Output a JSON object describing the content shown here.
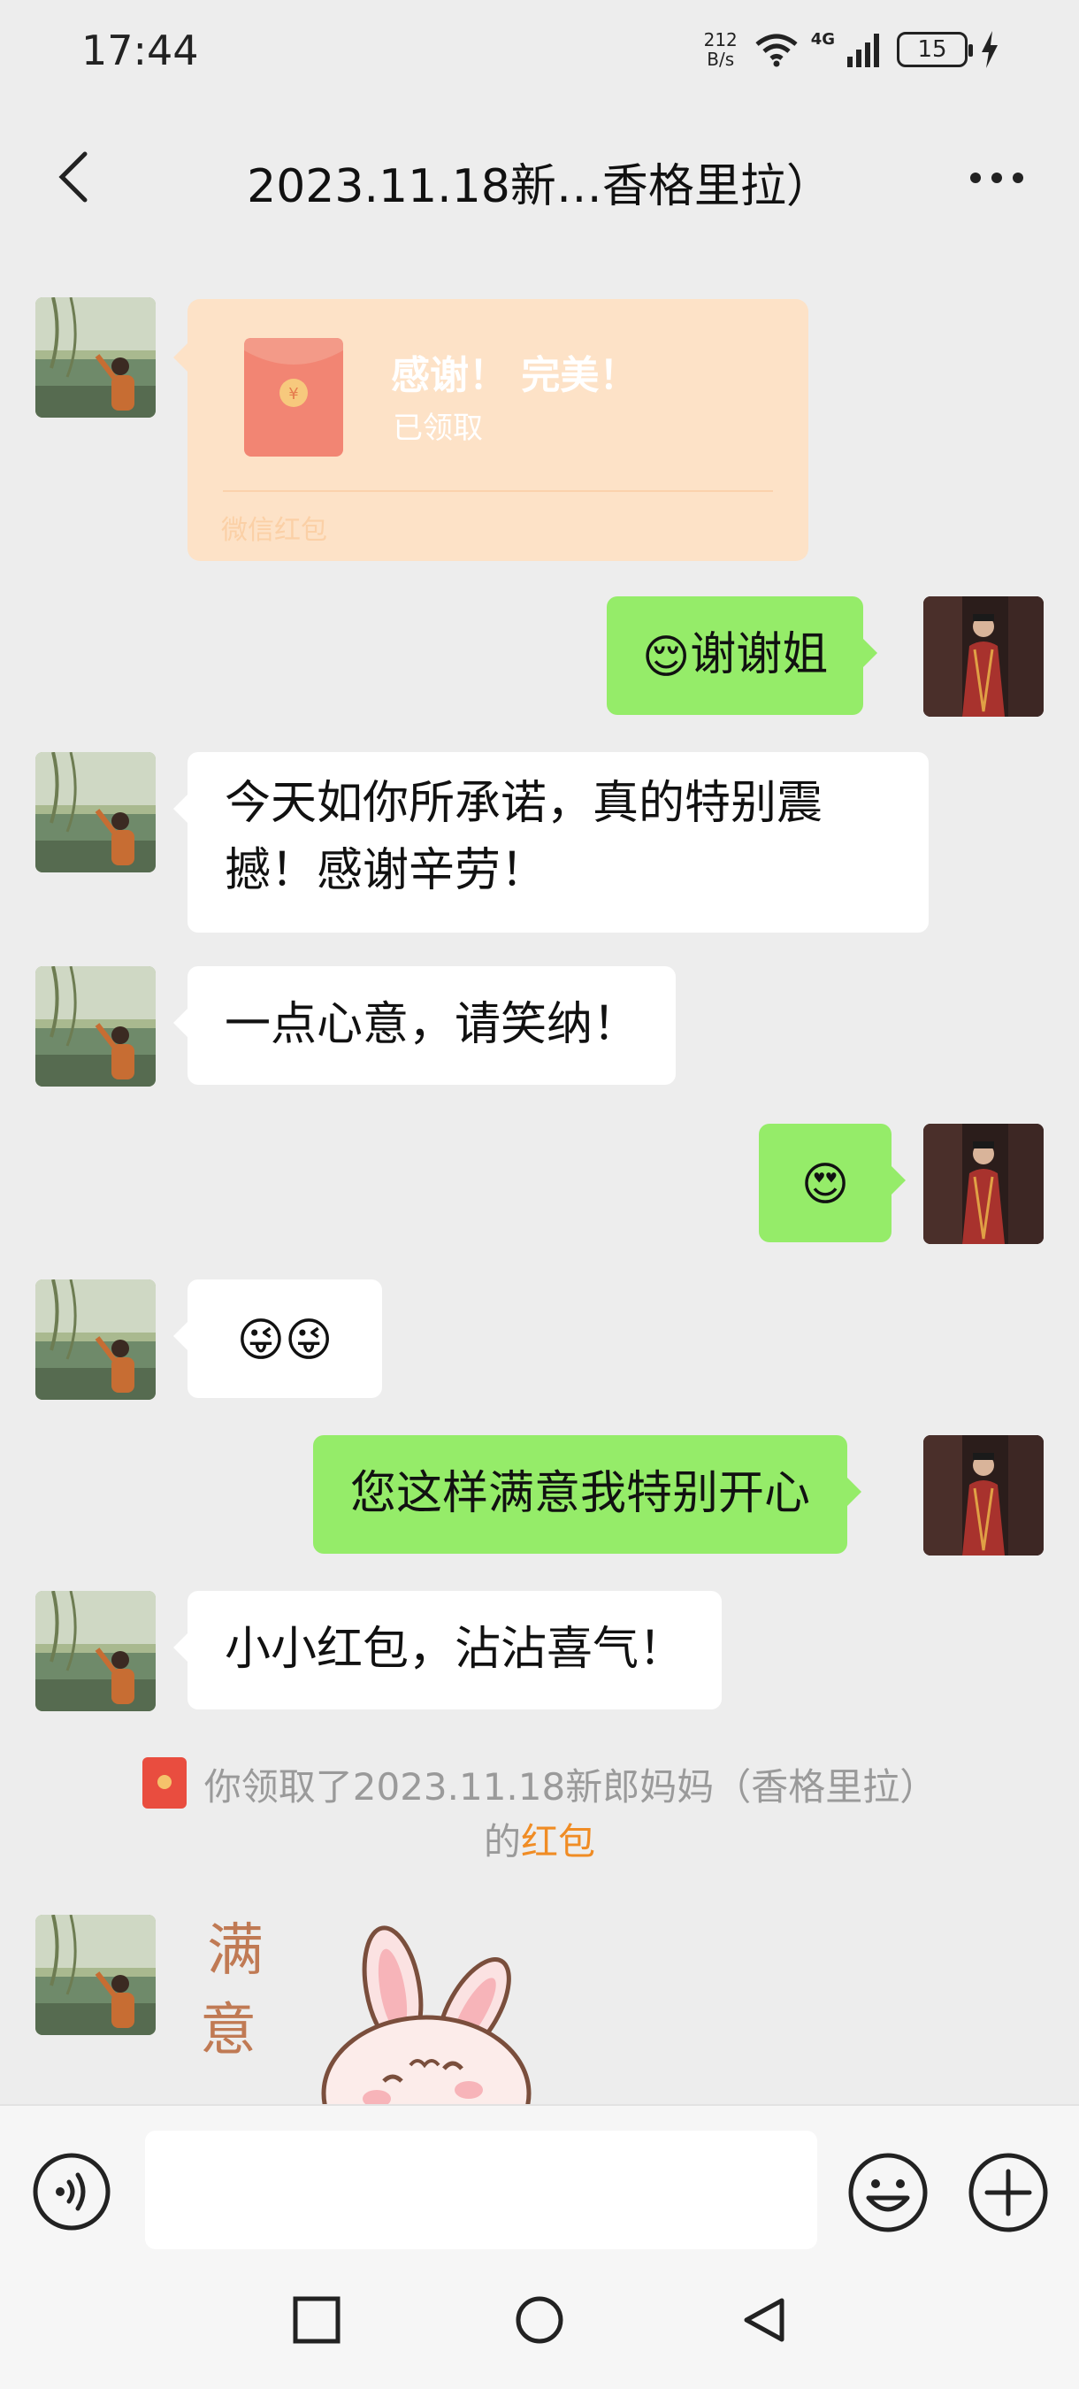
{
  "status_bar": {
    "time": "17:44",
    "net_speed_value": "212",
    "net_speed_unit": "B/s",
    "network_type": "4G",
    "battery_level": "15"
  },
  "header": {
    "title": "2023.11.18新…香格里拉）"
  },
  "messages": [
    {
      "id": 1,
      "side": "left",
      "type": "red-packet",
      "title": "感谢！ 完美！",
      "status": "已领取",
      "footer": "微信红包"
    },
    {
      "id": 2,
      "side": "right",
      "type": "text",
      "emoji": "😌",
      "text": "谢谢姐"
    },
    {
      "id": 3,
      "side": "left",
      "type": "text",
      "text_line1": "今天如你所承诺，真的特别震",
      "text_line2": "撼！感谢辛劳！"
    },
    {
      "id": 4,
      "side": "left",
      "type": "text",
      "text": "一点心意，请笑纳！"
    },
    {
      "id": 5,
      "side": "right",
      "type": "emoji",
      "emoji": "😍"
    },
    {
      "id": 6,
      "side": "left",
      "type": "emoji",
      "emoji": "😜😜"
    },
    {
      "id": 7,
      "side": "right",
      "type": "text",
      "text": "您这样满意我特别开心"
    },
    {
      "id": 8,
      "side": "left",
      "type": "text",
      "text": "小小红包，沾沾喜气！"
    },
    {
      "id": 9,
      "side": "left",
      "type": "sticker",
      "text": "满意"
    }
  ],
  "system_notice": {
    "line1": "你领取了2023.11.18新郎妈妈（香格里拉）",
    "line2_prefix": "的",
    "line2_link": "红包"
  },
  "input_bar": {
    "placeholder": "",
    "value": ""
  },
  "colors": {
    "background": "#ededed",
    "green_bubble": "#95ec69",
    "red_packet": "#fde2c7",
    "link": "#f08c24"
  }
}
